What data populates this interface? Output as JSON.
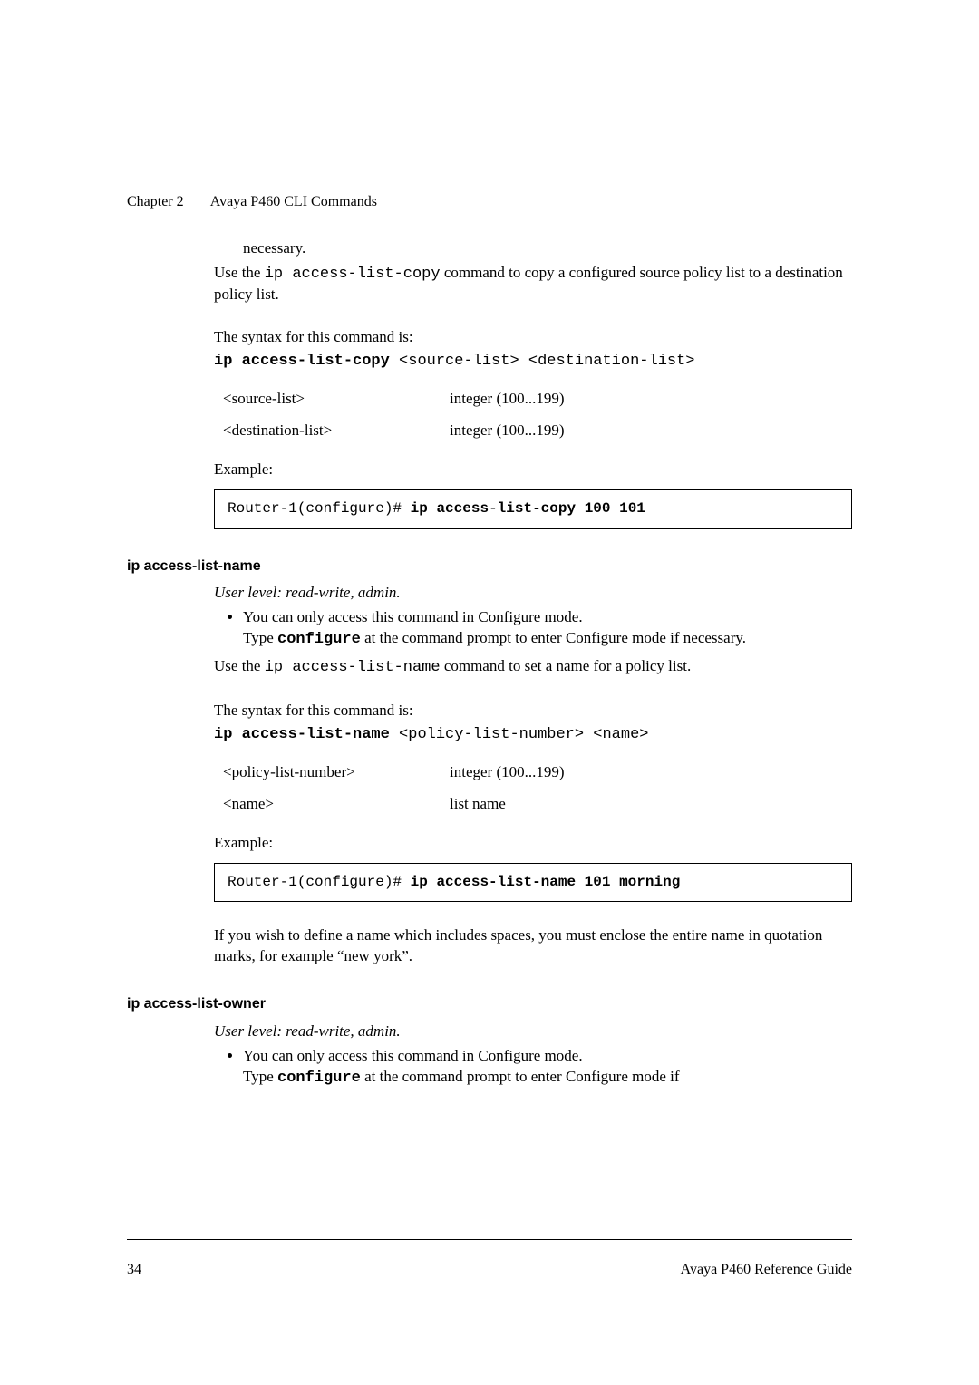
{
  "header": {
    "chapter": "Chapter 2",
    "title": "Avaya P460 CLI Commands"
  },
  "section1": {
    "necessary_trail": "necessary.",
    "use_pre": "Use the ",
    "use_cmd": "ip access-list-copy",
    "use_post": " command to copy a configured source policy list to a destination policy list.",
    "syntax_intro": "The syntax for this command is:",
    "syntax_cmd_bold": "ip access-list-copy",
    "syntax_cmd_args": " <source-list> <destination-list>",
    "params": [
      {
        "name": "<source-list>",
        "desc": "integer (100...199)"
      },
      {
        "name": "<destination-list>",
        "desc": "integer (100...199)"
      }
    ],
    "example_label": "Example:",
    "example_prefix": "Router-1(configure)# ",
    "example_bold1": "ip access",
    "example_dash": "-",
    "example_bold2": "list-copy 100 101"
  },
  "section2": {
    "heading": "ip access-list-name",
    "user_level": "User level: read-write, admin.",
    "bullet_line1": "You can only access this command in Configure mode.",
    "bullet_line2_pre": "Type ",
    "bullet_line2_cmd": "configure",
    "bullet_line2_post": " at the command prompt to enter Configure mode if necessary.",
    "use_pre": "Use the ",
    "use_cmd": "ip access-list-name",
    "use_post": " command to set a name for a policy list.",
    "syntax_intro": "The syntax for this command is:",
    "syntax_cmd_bold": "ip access-list-name",
    "syntax_cmd_args": " <policy-list-number> <name>",
    "params": [
      {
        "name": "<policy-list-number>",
        "desc": "integer (100...199)"
      },
      {
        "name": "<name>",
        "desc": "list name"
      }
    ],
    "example_label": "Example:",
    "example_prefix": "Router-1(configure)# ",
    "example_bold": "ip access-list-name 101 morning",
    "note": "If you wish to define a name which includes spaces, you must enclose the entire name in quotation marks, for example “new york”."
  },
  "section3": {
    "heading": "ip access-list-owner",
    "user_level": "User level: read-write, admin.",
    "bullet_line1": "You can only access this command in Configure mode.",
    "bullet_line2_pre": "Type ",
    "bullet_line2_cmd": "configure",
    "bullet_line2_post": " at the command prompt to enter Configure mode if"
  },
  "footer": {
    "page_number": "34",
    "doc_title": "Avaya P460 Reference Guide"
  }
}
